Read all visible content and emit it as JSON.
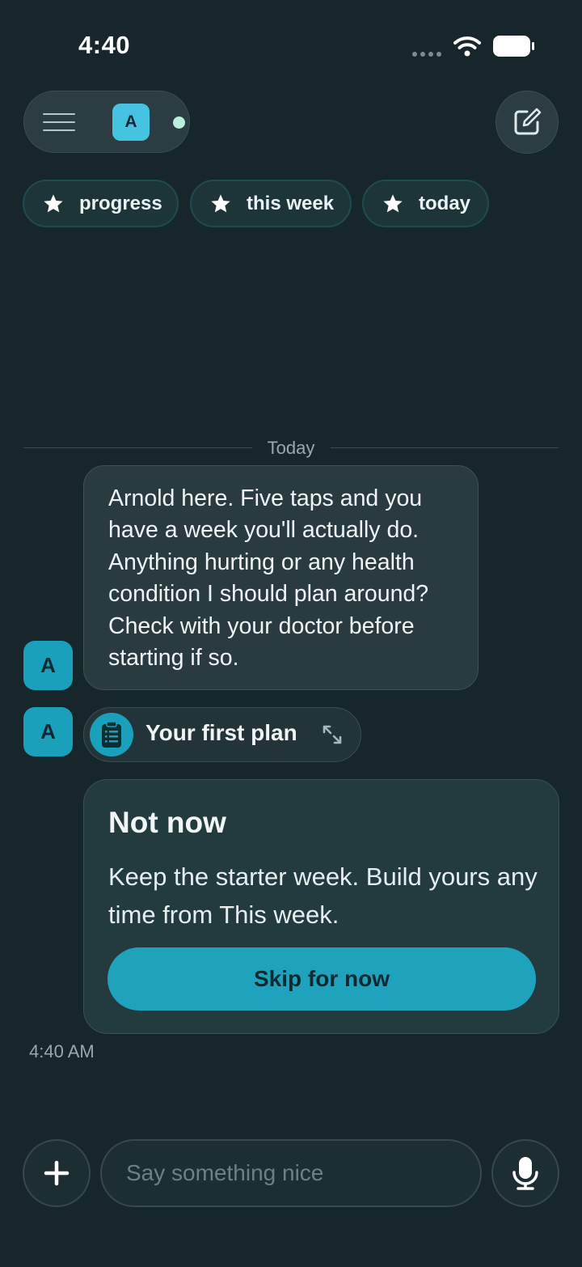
{
  "status_bar": {
    "time": "4:40"
  },
  "header": {
    "avatar_initial": "A"
  },
  "chips": [
    {
      "label": "progress",
      "icon": "star-icon"
    },
    {
      "label": "this week",
      "icon": "star-icon"
    },
    {
      "label": "today",
      "icon": "star-icon"
    }
  ],
  "chat": {
    "date_divider": "Today",
    "messages": [
      {
        "avatar": "A",
        "text": "Arnold here. Five taps and you have a week you'll actually do. Anything hurting or any health condition I should plan around? Check with your doctor before starting if so."
      },
      {
        "avatar": "A",
        "attachment_label": "Your first plan",
        "attachment_icon": "clipboard-icon"
      }
    ],
    "card": {
      "title": "Not now",
      "body": "Keep the starter week. Build yours any time from This week.",
      "button_label": "Skip for now"
    },
    "timestamp": "4:40 AM"
  },
  "composer": {
    "placeholder": "Say something nice"
  },
  "colors": {
    "background": "#17262b",
    "accent": "#1fa3bc",
    "avatar_header": "#46c3e0"
  }
}
